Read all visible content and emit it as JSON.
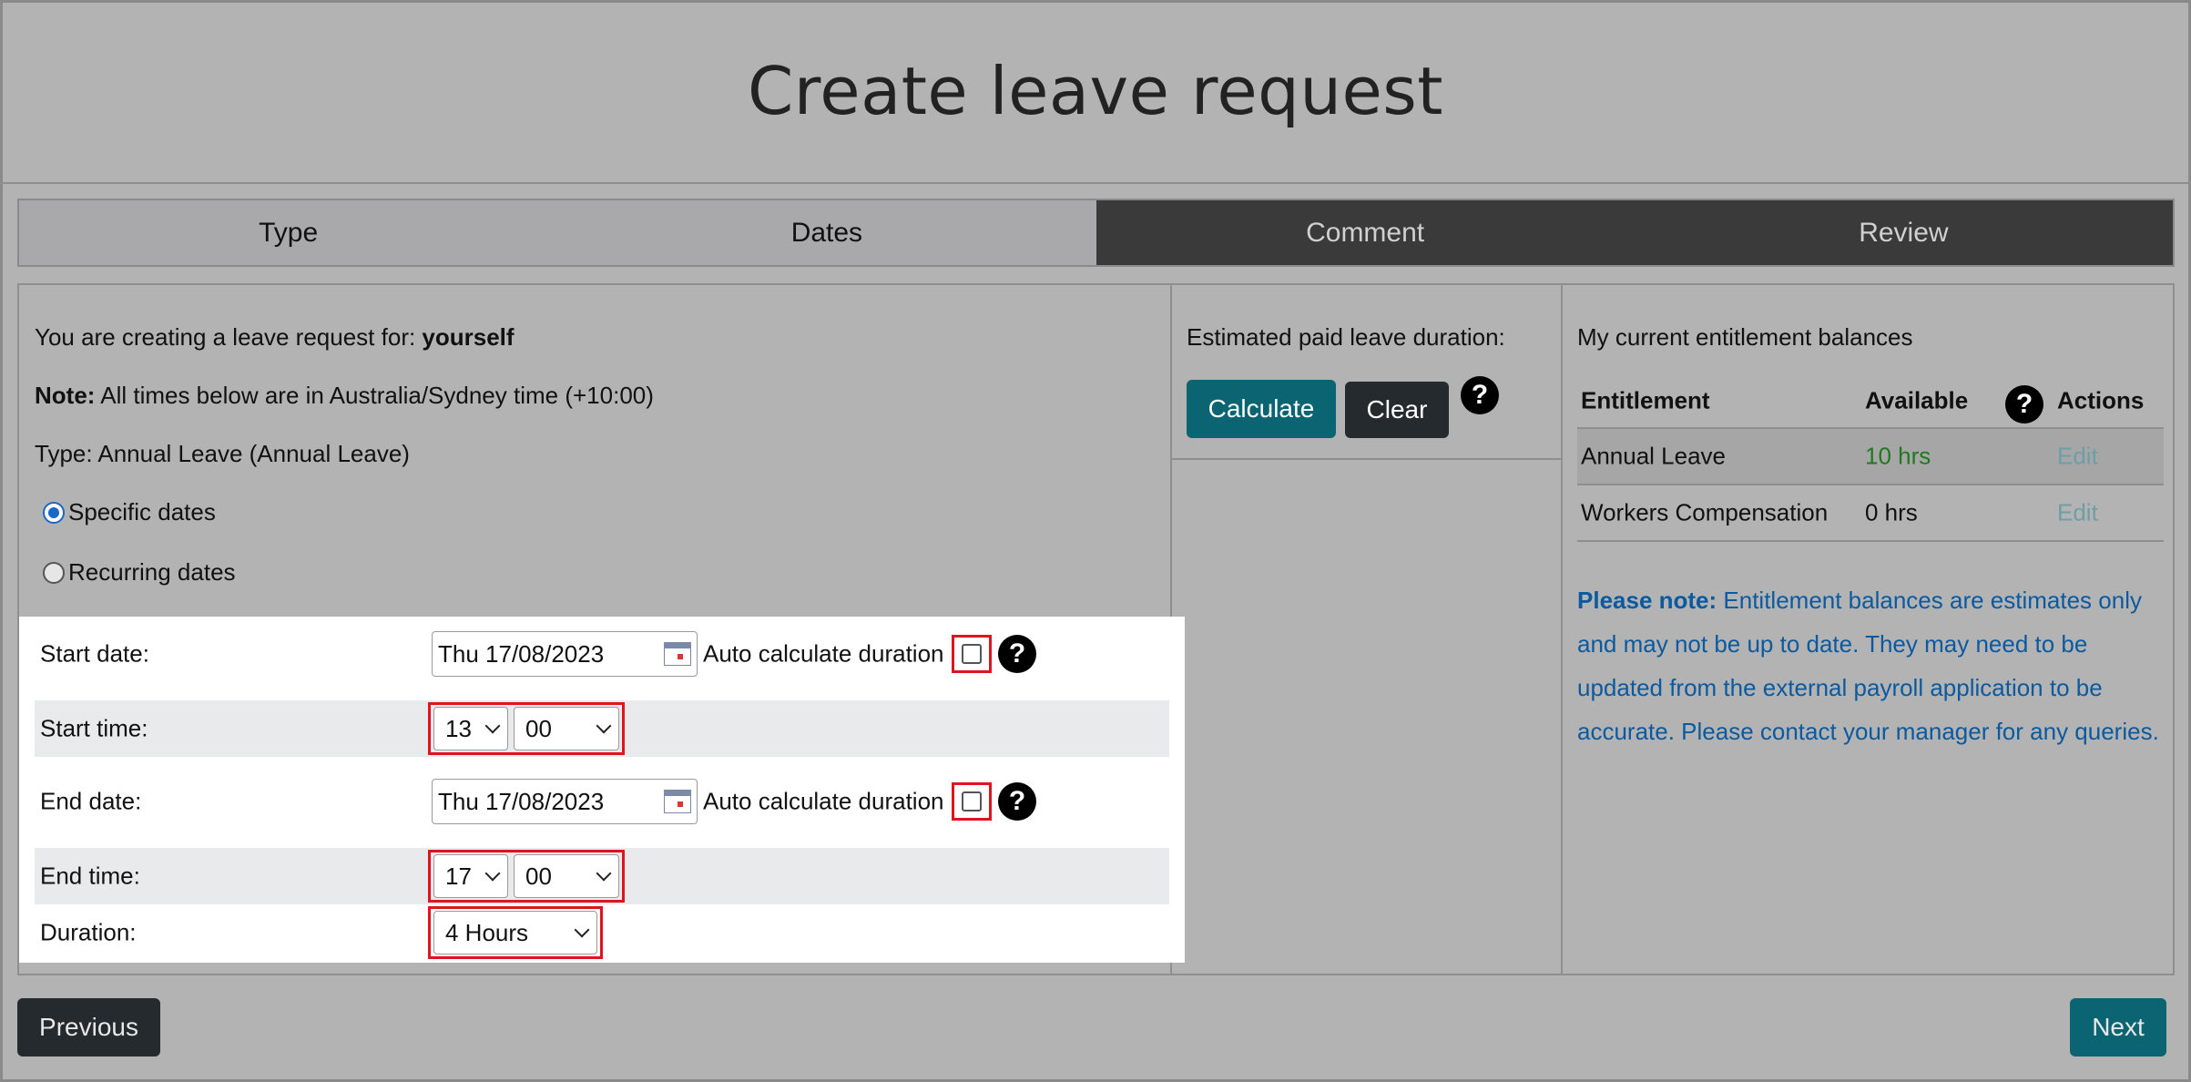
{
  "title": "Create leave request",
  "steps": [
    {
      "label": "Type"
    },
    {
      "label": "Dates"
    },
    {
      "label": "Comment"
    },
    {
      "label": "Review"
    }
  ],
  "info": {
    "creating_prefix": "You are creating a leave request for: ",
    "creating_for": "yourself",
    "note_label": "Note:",
    "note_text": " All times below are in Australia/Sydney time (+10:00)",
    "type_text": "Type: Annual Leave (Annual Leave)"
  },
  "date_mode": {
    "specific": "Specific dates",
    "recurring": "Recurring dates",
    "selected": "Specific dates"
  },
  "form": {
    "start_date_label": "Start date:",
    "start_date_value": "Thu 17/08/2023",
    "start_time_label": "Start time:",
    "start_hour": "13",
    "start_minute": "00",
    "end_date_label": "End date:",
    "end_date_value": "Thu 17/08/2023",
    "end_time_label": "End time:",
    "end_hour": "17",
    "end_minute": "00",
    "duration_label": "Duration:",
    "duration_value": "4 Hours",
    "auto_calc_label": "Auto calculate duration"
  },
  "estimate": {
    "label": "Estimated paid leave duration:",
    "calculate": "Calculate",
    "clear": "Clear"
  },
  "entitlements": {
    "title": "My current entitlement balances",
    "headers": {
      "entitlement": "Entitlement",
      "available": "Available",
      "actions": "Actions"
    },
    "rows": [
      {
        "name": "Annual Leave",
        "available": "10 hrs",
        "action": "Edit"
      },
      {
        "name": "Workers Compensation",
        "available": "0 hrs",
        "action": "Edit"
      }
    ],
    "note_label": "Please note:",
    "note_text": " Entitlement balances are estimates only and may not be up to date. They may need to be updated from the external payroll application to be accurate. Please contact your manager for any queries."
  },
  "nav": {
    "previous": "Previous",
    "next": "Next"
  },
  "colors": {
    "teal": "#0b6471",
    "dark": "#242a2d",
    "highlight_red": "#e0141e",
    "note_blue": "#0b5aa0"
  }
}
